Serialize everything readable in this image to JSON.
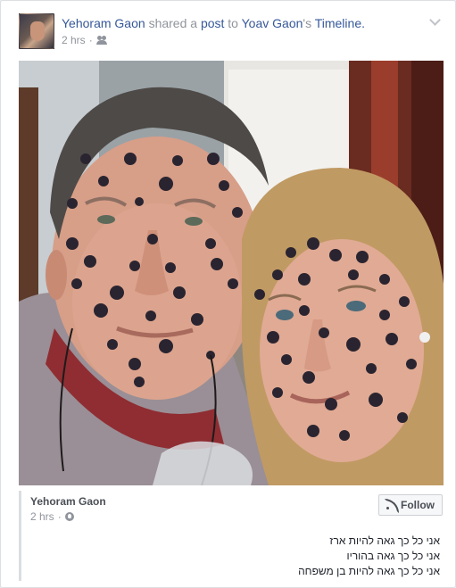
{
  "post": {
    "author": "Yehoram Gaon",
    "shared_word": "shared a",
    "post_word": "post",
    "to_word": "to",
    "target": "Yoav Gaon",
    "possessive_suffix": "'s",
    "timeline_word": "Timeline.",
    "time": "2 hrs",
    "separator": "·",
    "audience_icon": "friends-icon",
    "menu_icon": "chevron-down-icon"
  },
  "shared_post": {
    "author": "Yehoram Gaon",
    "time": "2 hrs",
    "separator": "·",
    "privacy_icon": "globe-icon",
    "follow_label": "Follow",
    "follow_icon": "rss-icon",
    "lines": [
      "אני כל כך גאה להיות ארז",
      "אני כל כך גאה בהוריו",
      "אני כל כך גאה להיות בן משפחה"
    ]
  },
  "colors": {
    "link": "#365899",
    "muted": "#90949c",
    "card_border": "#dddfe2"
  }
}
